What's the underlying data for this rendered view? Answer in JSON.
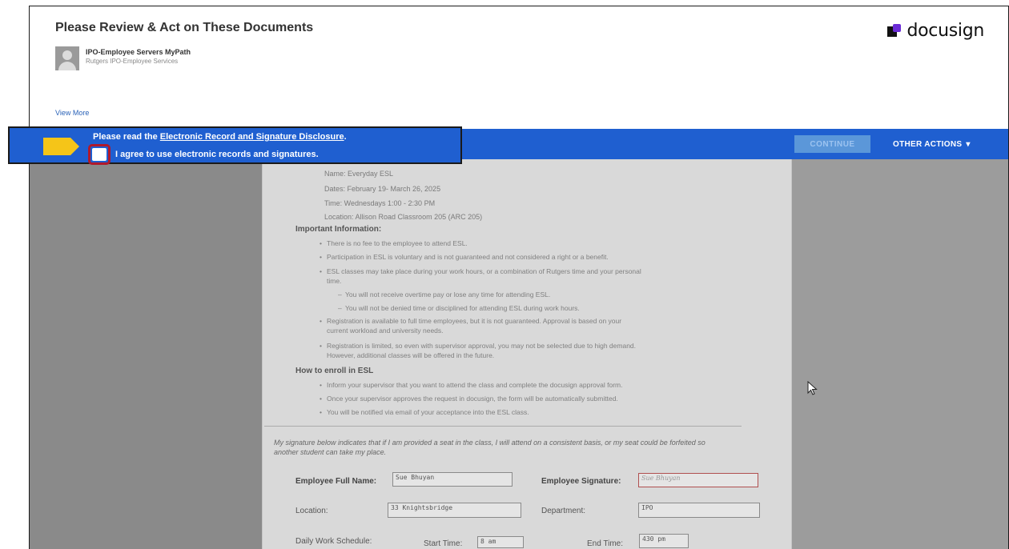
{
  "header": {
    "title": "Please Review & Act on These Documents",
    "logo_text": "docusign",
    "sender_name": "IPO-Employee Servers MyPath",
    "sender_org": "Rutgers IPO-Employee Services",
    "view_more": "View More"
  },
  "action_bar": {
    "disclosure_prefix": "Please read the ",
    "disclosure_link": "Electronic Record and Signature Disclosure",
    "disclosure_suffix": ".",
    "agree_label": "I agree to use electronic records and signatures.",
    "continue_label": "CONTINUE",
    "other_actions_label": "OTHER ACTIONS",
    "other_actions_caret": "▾"
  },
  "document": {
    "class_info": [
      "Name: Everyday ESL",
      "Dates: February 19- March 26, 2025",
      "Time: Wednesdays 1:00 - 2:30 PM",
      "Location: Allison Road Classroom 205 (ARC 205)"
    ],
    "important_heading": "Important Information:",
    "important_items": [
      "There is no fee to the employee to attend ESL.",
      "Participation in ESL is voluntary and is not guaranteed and not considered a right or a benefit.",
      "ESL classes may take place during your work hours, or a combination of Rutgers time and your personal",
      "time.",
      "You will not receive overtime pay or lose any time for attending ESL.",
      "You will not be denied time or disciplined for attending ESL during work hours.",
      "Registration is available to full time employees, but it is not guaranteed. Approval is based on your",
      "current workload and university needs.",
      "Registration is limited, so even with supervisor approval, you may not be selected due to high demand.",
      "However, additional classes will be offered in the future."
    ],
    "enroll_heading": "How to enroll in ESL",
    "enroll_items": [
      "Inform your supervisor that you want to attend the class and complete the docusign approval form.",
      "Once your supervisor approves the request in docusign, the form will be automatically submitted.",
      "You will be notified via email of your acceptance into the ESL class."
    ],
    "signature_note": "My signature below indicates that if I am provided a seat in the class, I will attend on a consistent basis, or my seat could be forfeited so another student can take my place.",
    "fields": {
      "full_name_label": "Employee Full Name:",
      "full_name_value": "Sue Bhuyan",
      "signature_label": "Employee Signature:",
      "signature_value": "Sue Bhuyan",
      "location_label": "Location:",
      "location_value": "33 Knightsbridge",
      "department_label": "Department:",
      "department_value": "IPO",
      "schedule_label": "Daily Work Schedule:",
      "start_label": "Start Time:",
      "start_value": "8 am",
      "end_label": "End Time:",
      "end_value": "430 pm"
    }
  },
  "colors": {
    "action_bar": "#1f5fd0",
    "arrow_tag": "#f5c518",
    "checkbox_highlight": "#b0192c",
    "logo_accent": "#6b2bd6"
  }
}
